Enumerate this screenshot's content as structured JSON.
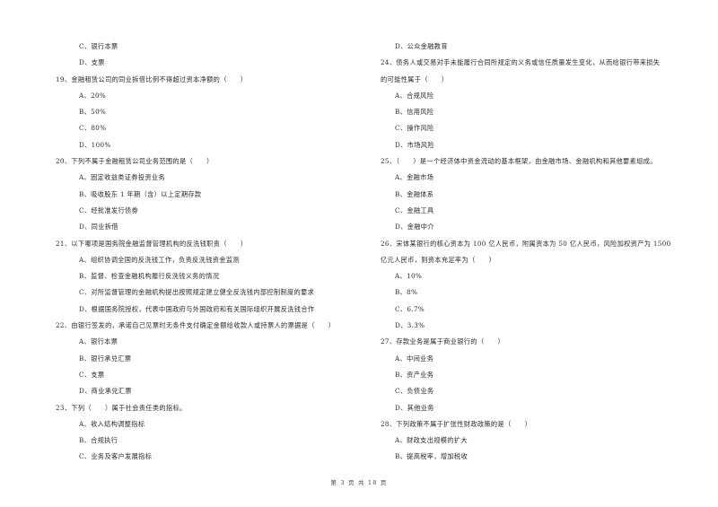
{
  "page": {
    "footer": "第 3 页 共 18 页"
  },
  "left_column": [
    {
      "type": "option",
      "text": "C、银行本票"
    },
    {
      "type": "option",
      "text": "D、支票"
    },
    {
      "type": "question",
      "text": "19、金融租赁公司的同业拆借比例不得超过资本净额的（　　）"
    },
    {
      "type": "option",
      "text": "A、20%"
    },
    {
      "type": "option",
      "text": "B、50%"
    },
    {
      "type": "option",
      "text": "C、80%"
    },
    {
      "type": "option",
      "text": "D、100%"
    },
    {
      "type": "question",
      "text": "20、下列不属于金融租赁公司业务范围的是（　　）"
    },
    {
      "type": "option",
      "text": "A、固定收益类证券投资业务"
    },
    {
      "type": "option",
      "text": "B、吸收股东 1 年期（含）以上定期存款"
    },
    {
      "type": "option",
      "text": "C、经批准发行债券"
    },
    {
      "type": "option",
      "text": "D、同业拆借"
    },
    {
      "type": "question",
      "text": "21、以下哪项是国务院金融监督管理机构的反洗钱职责（　　）"
    },
    {
      "type": "option",
      "text": "A、组织协调全国的反洗钱工作，负责反洗钱资金监测"
    },
    {
      "type": "option",
      "text": "B、监督、检查金融机构履行反洗钱义务的情况"
    },
    {
      "type": "option",
      "text": "C、对所监督管理的金融机构提出按照规定建立健全反洗钱内部控制制度的要求"
    },
    {
      "type": "option",
      "text": "D、根据国务院授权，代表中国政府与外国政府和有关国际组织开展反洗钱合作"
    },
    {
      "type": "question",
      "text": "22、由银行签发的，承诺自己见票时无条件支付确定金额给收款人或持票人的票据是（　　）"
    },
    {
      "type": "option",
      "text": "A、银行本票"
    },
    {
      "type": "option",
      "text": "B、银行承兑汇票"
    },
    {
      "type": "option",
      "text": "C、支票"
    },
    {
      "type": "option",
      "text": "D、商业承兑汇票"
    },
    {
      "type": "question",
      "text": "23、下列（　　）属于社会责任类的指标。"
    },
    {
      "type": "option",
      "text": "A、收入结构调整指标"
    },
    {
      "type": "option",
      "text": "B、合规执行"
    },
    {
      "type": "option",
      "text": "C、业务及客户发展指标"
    }
  ],
  "right_column": [
    {
      "type": "option",
      "text": "D、公众金融教育"
    },
    {
      "type": "question",
      "text": "24、债务人或交易对手未能履行合同所规定的义务或信任质量发生变化，从而给银行带来损失"
    },
    {
      "type": "continuation",
      "text": "的可能性属于（　　）"
    },
    {
      "type": "option",
      "text": "A、合规风险"
    },
    {
      "type": "option",
      "text": "B、信用风险"
    },
    {
      "type": "option",
      "text": "C、操作风险"
    },
    {
      "type": "option",
      "text": "D、市场风险"
    },
    {
      "type": "question",
      "text": "25、（　　）是一个经济体中资金流动的基本框架，由金融市场、金融机构和其他要素组成。"
    },
    {
      "type": "option",
      "text": "A、金融市场"
    },
    {
      "type": "option",
      "text": "B、金融体系"
    },
    {
      "type": "option",
      "text": "C、金融工具"
    },
    {
      "type": "option",
      "text": "D、金融中介"
    },
    {
      "type": "question",
      "text": "26、宋体某银行的核心资本为 100 亿人民币，附属资本为 50 亿人民币，风险加权资产为 1500"
    },
    {
      "type": "continuation",
      "text": "亿元人民币，则资本充足率为（　　）"
    },
    {
      "type": "option",
      "text": "A、10%"
    },
    {
      "type": "option",
      "text": "B、8%"
    },
    {
      "type": "option",
      "text": "C、6.7%"
    },
    {
      "type": "option",
      "text": "D、3.3%"
    },
    {
      "type": "question",
      "text": "27、存款业务是属于商业银行的（　　）"
    },
    {
      "type": "option",
      "text": "A、中间业务"
    },
    {
      "type": "option",
      "text": "B、资产业务"
    },
    {
      "type": "option",
      "text": "C、负债业务"
    },
    {
      "type": "option",
      "text": "D、其他业务"
    },
    {
      "type": "question",
      "text": "28、下列政策不属于扩张性财政政策的是（　　）"
    },
    {
      "type": "option",
      "text": "A、财政支出规模的扩大"
    },
    {
      "type": "option",
      "text": "B、提高税率，增加税收"
    }
  ]
}
